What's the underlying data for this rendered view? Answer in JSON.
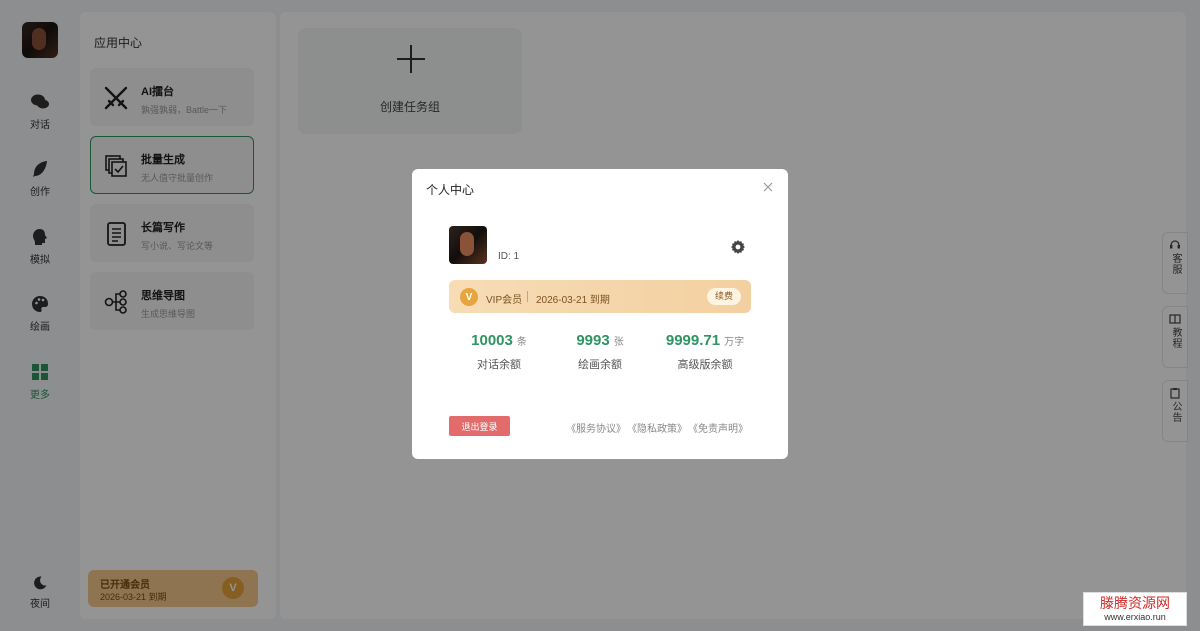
{
  "rail": {
    "items": [
      {
        "label": "对话",
        "icon": "chat-bubbles-icon"
      },
      {
        "label": "创作",
        "icon": "feather-icon"
      },
      {
        "label": "模拟",
        "icon": "head-profile-icon"
      },
      {
        "label": "绘画",
        "icon": "palette-icon"
      },
      {
        "label": "更多",
        "icon": "grid-icon",
        "active": true
      }
    ],
    "night_label": "夜间",
    "night_icon": "moon-icon"
  },
  "panel": {
    "title": "应用中心",
    "apps": [
      {
        "name": "AI擂台",
        "desc": "孰强孰弱，Battle一下",
        "icon": "crossed-swords-icon"
      },
      {
        "name": "批量生成",
        "desc": "无人值守批量创作",
        "icon": "batch-copy-icon",
        "selected": true
      },
      {
        "name": "长篇写作",
        "desc": "写小说、写论文等",
        "icon": "document-icon"
      },
      {
        "name": "思维导图",
        "desc": "生成思维导图",
        "icon": "mindmap-icon"
      }
    ],
    "member": {
      "title": "已开通会员",
      "expiry": "2026-03-21 到期",
      "badge": "V"
    }
  },
  "main": {
    "create_label": "创建任务组"
  },
  "side_tabs": [
    {
      "label": "客服",
      "icon": "headset-icon"
    },
    {
      "label": "教程",
      "icon": "book-icon"
    },
    {
      "label": "公告",
      "icon": "clipboard-icon"
    }
  ],
  "modal": {
    "title": "个人中心",
    "user_id": "ID: 1",
    "vip": {
      "badge": "V",
      "label": "VIP会员",
      "expiry": "2026-03-21 到期",
      "renew": "续费"
    },
    "stats": [
      {
        "value": "10003",
        "unit": "条",
        "label": "对话余额"
      },
      {
        "value": "9993",
        "unit": "张",
        "label": "绘画余额"
      },
      {
        "value": "9999.71",
        "unit": "万字",
        "label": "高级版余额"
      }
    ],
    "logout": "退出登录",
    "links": [
      "《服务协议》",
      "《隐私政策》",
      "《免责声明》"
    ]
  },
  "watermark": {
    "line1": "滕腾资源网",
    "line2": "www.erxiao.run"
  },
  "colors": {
    "accent": "#2f9462",
    "vip_gold": "#e6a53f",
    "logout_red": "#e26c6c"
  }
}
